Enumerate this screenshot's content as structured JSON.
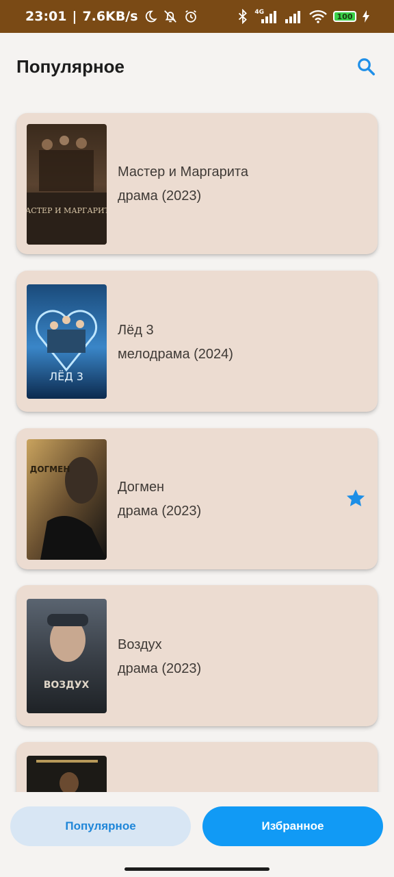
{
  "status_bar": {
    "time": "23:01",
    "separator": "|",
    "network_speed": "7.6KB/s",
    "network_type": "4G",
    "battery_level": "100",
    "icons": [
      "moon-icon",
      "alarm-off-icon",
      "alarm-icon",
      "bluetooth-icon",
      "signal-icon",
      "signal-icon",
      "wifi-icon",
      "battery-icon",
      "charging-icon"
    ]
  },
  "header": {
    "title": "Популярное",
    "search_icon": "search-icon"
  },
  "movies": [
    {
      "title": "Мастер и Маргарита",
      "meta": "драма (2023)",
      "favorite": false,
      "poster_text": "МАСТЕР И МАРГАРИТА"
    },
    {
      "title": "Лёд 3",
      "meta": "мелодрама (2024)",
      "favorite": false,
      "poster_text": "ЛЁД 3"
    },
    {
      "title": "Догмен",
      "meta": "драма (2023)",
      "favorite": true,
      "poster_text": "ДОГМЕН"
    },
    {
      "title": "Воздух",
      "meta": "драма (2023)",
      "favorite": false,
      "poster_text": "ВОЗДУХ"
    }
  ],
  "bottom_nav": {
    "popular_label": "Популярное",
    "favorites_label": "Избранное"
  },
  "colors": {
    "accent": "#119af5",
    "card_background": "#ecdcd1",
    "status_bar": "#7a4a15",
    "star": "#1e8fe6"
  }
}
